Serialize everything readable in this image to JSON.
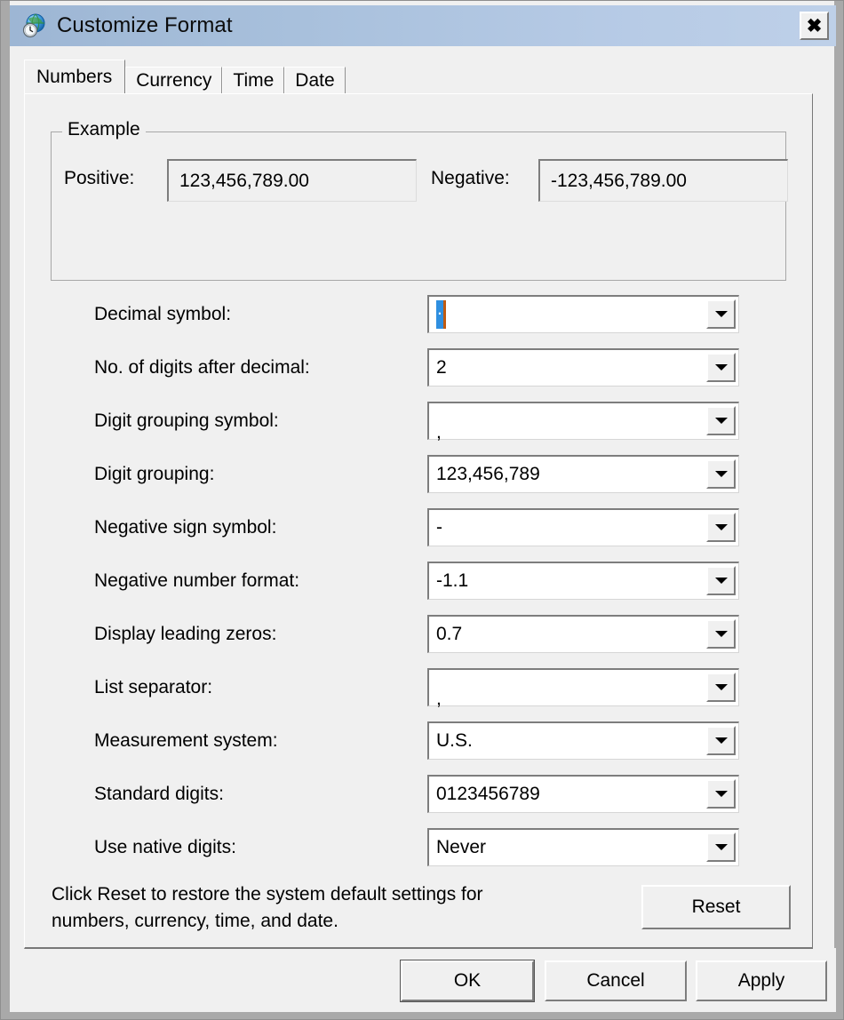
{
  "window": {
    "title": "Customize Format",
    "icon": "globe-clock-icon",
    "close_label": "✕",
    "frame_color": "#a9a9a9",
    "titlebar_color": "#a8c0dc",
    "dialog_bg": "#f0f0f0"
  },
  "tabs": [
    {
      "label": "Numbers",
      "selected": true
    },
    {
      "label": "Currency",
      "selected": false
    },
    {
      "label": "Time",
      "selected": false
    },
    {
      "label": "Date",
      "selected": false
    }
  ],
  "example": {
    "legend": "Example",
    "positive_label": "Positive:",
    "positive_value": "123,456,789.00",
    "negative_label": "Negative:",
    "negative_value": "-123,456,789.00"
  },
  "fields": [
    {
      "label": "Decimal symbol:",
      "value": ".",
      "selected": true,
      "baseline": false
    },
    {
      "label": "No. of digits after decimal:",
      "value": "2",
      "selected": false,
      "baseline": false
    },
    {
      "label": "Digit grouping symbol:",
      "value": ",",
      "selected": false,
      "baseline": true
    },
    {
      "label": "Digit grouping:",
      "value": "123,456,789",
      "selected": false,
      "baseline": false
    },
    {
      "label": "Negative sign symbol:",
      "value": "-",
      "selected": false,
      "baseline": false
    },
    {
      "label": "Negative number format:",
      "value": "-1.1",
      "selected": false,
      "baseline": false
    },
    {
      "label": "Display leading zeros:",
      "value": "0.7",
      "selected": false,
      "baseline": false
    },
    {
      "label": "List separator:",
      "value": ",",
      "selected": false,
      "baseline": true
    },
    {
      "label": "Measurement system:",
      "value": "U.S.",
      "selected": false,
      "baseline": false
    },
    {
      "label": "Standard digits:",
      "value": "0123456789",
      "selected": false,
      "baseline": false
    },
    {
      "label": "Use native digits:",
      "value": "Never",
      "selected": false,
      "baseline": false
    }
  ],
  "reset": {
    "text_line1": "Click Reset to restore the system default settings for",
    "text_line2": "numbers, currency, time, and date.",
    "button_label": "Reset"
  },
  "buttons": {
    "ok": "OK",
    "cancel": "Cancel",
    "apply": "Apply"
  },
  "selection_color": "#2f8fe0",
  "caret_color": "#c05a10"
}
